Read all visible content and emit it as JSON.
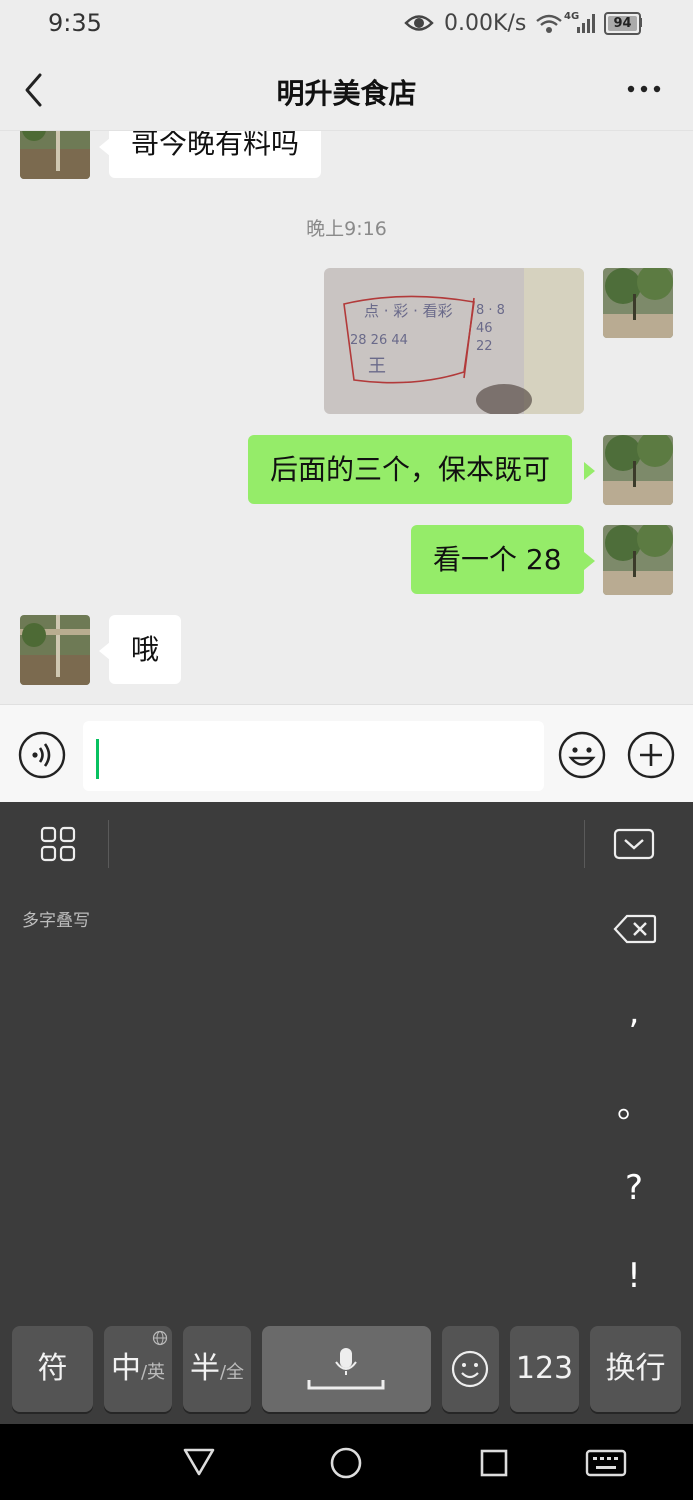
{
  "status_bar": {
    "time": "9:35",
    "net_speed": "0.00K/s",
    "network": "4G",
    "battery": "94"
  },
  "header": {
    "title": "明升美食店",
    "back_icon": "back-chevron-icon",
    "more_icon": "more-dots-icon"
  },
  "messages": [
    {
      "side": "in",
      "text": "哥今晚有料吗"
    },
    {
      "type": "timestamp",
      "text": "晚上9:16"
    },
    {
      "side": "out",
      "type": "image"
    },
    {
      "side": "out",
      "text": "后面的三个，保本既可"
    },
    {
      "side": "out",
      "text": "看一个 28"
    },
    {
      "side": "in",
      "text": "哦"
    }
  ],
  "input_bar": {
    "voice_icon": "voice-icon",
    "emoji_icon": "emoji-icon",
    "plus_icon": "plus-icon"
  },
  "keyboard": {
    "hint": "多字叠写",
    "side_keys": [
      ",",
      "。",
      "?",
      "!"
    ],
    "bottom_keys": {
      "symbols": "符",
      "lang_main": "中",
      "lang_sub": "/英",
      "width_main": "半",
      "width_sub": "/全",
      "numbers": "123",
      "enter": "换行"
    }
  },
  "colors": {
    "bubble_out": "#95ec69",
    "bubble_in": "#ffffff",
    "keyboard_bg": "#3c3c3c",
    "cursor": "#07c160"
  }
}
